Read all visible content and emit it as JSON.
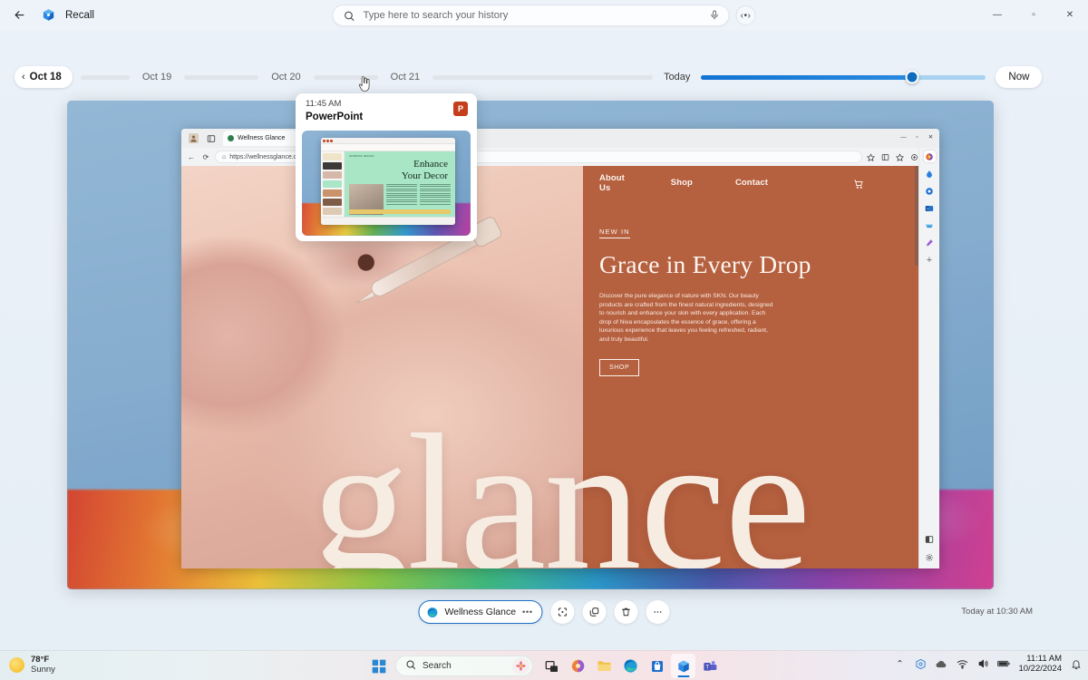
{
  "titlebar": {
    "back_icon": "back-arrow-icon",
    "app_icon": "recall-app-icon",
    "title": "Recall",
    "minimize": "—",
    "maximize": "▫",
    "close": "✕"
  },
  "search": {
    "placeholder": "Type here to search your history",
    "value": "",
    "search_icon": "search-icon",
    "mic_icon": "microphone-icon",
    "more_label": "‹•›"
  },
  "timeline": {
    "current_day": "Oct 18",
    "chevron": "‹",
    "days": [
      "Oct 19",
      "Oct 20",
      "Oct 21"
    ],
    "today_label": "Today",
    "now_label": "Now",
    "slider_percent": 74
  },
  "tooltip": {
    "time": "11:45 AM",
    "app": "PowerPoint",
    "app_icon": "powerpoint-icon",
    "app_icon_letter": "P",
    "slide_title_line1": "Enhance",
    "slide_title_line2": "Your Decor"
  },
  "snapshot": {
    "browser": {
      "profile_icon": "profile-icon",
      "tabs_icon": "tab-list-icon",
      "tab_title": "Wellness Glance",
      "tab_close": "✕",
      "back_icon": "←",
      "reload_icon": "⟳",
      "lock_icon": "⌂",
      "url": "https://wellnessglance.com",
      "minimize": "—",
      "maximize": "▫",
      "close": "✕",
      "toolbar_icons": [
        "favorite-icon",
        "collections-icon",
        "split-screen-icon",
        "browser-essentials-icon",
        "settings-more-icon"
      ],
      "sidebar_icons": [
        "copilot-icon",
        "edge-drop-icon",
        "browser-essentials-icon",
        "outlook-icon",
        "games-icon",
        "tools-icon",
        "add-icon"
      ],
      "sidebar_bottom_icons": [
        "contrast-icon",
        "settings-gear-icon"
      ]
    },
    "site": {
      "nav": [
        "About Us",
        "Shop",
        "Contact"
      ],
      "cart_icon": "shopping-cart-icon",
      "account_icon": "account-icon",
      "kicker": "NEW IN",
      "headline": "Grace in Every Drop",
      "body": "Discover the pure elegance of nature with SKN. Our beauty products are crafted from the finest natural ingredients, designed to nourish and enhance your skin with every application. Each drop of Niva encapsulates the essence of grace, offering a luxurious experience that leaves you feeling refreshed, radiant, and truly beautiful.",
      "cta": "SHOP",
      "big_word": "glance"
    }
  },
  "actionbar": {
    "app_name": "Wellness Glance",
    "app_icon": "edge-icon",
    "app_more": "•••",
    "buttons": [
      {
        "name": "screen-select-button",
        "icon": "⌗"
      },
      {
        "name": "copy-button",
        "icon": "⧉"
      },
      {
        "name": "delete-button",
        "icon": "Ὕ1"
      },
      {
        "name": "more-options-button",
        "icon": "•••"
      }
    ],
    "timestamp": "Today at 10:30 AM"
  },
  "taskbar": {
    "weather_temp": "78°F",
    "weather_desc": "Sunny",
    "weather_icon": "sun-icon",
    "start_icon": "windows-start-icon",
    "search_placeholder": "Search",
    "search_icon": "search-icon",
    "search_badge_icon": "flower-icon",
    "apps": [
      {
        "name": "task-view-icon",
        "label": "task-view"
      },
      {
        "name": "copilot-icon",
        "label": "copilot"
      },
      {
        "name": "file-explorer-icon",
        "label": "file-explorer"
      },
      {
        "name": "edge-icon",
        "label": "edge"
      },
      {
        "name": "microsoft-store-icon",
        "label": "store"
      },
      {
        "name": "recall-icon",
        "label": "recall"
      },
      {
        "name": "teams-icon",
        "label": "teams"
      }
    ],
    "tray": {
      "chevron": "⌃",
      "icons": [
        "recall-tray-icon",
        "onedrive-icon",
        "wifi-icon",
        "volume-icon",
        "battery-icon"
      ],
      "time": "11:11 AM",
      "date": "10/22/2024",
      "notification_icon": "bell-icon"
    }
  },
  "colors": {
    "accent": "#0f6cbd",
    "site_brand": "#b5603f",
    "site_cream": "#f7ece2",
    "powerpoint": "#c43e1c"
  }
}
